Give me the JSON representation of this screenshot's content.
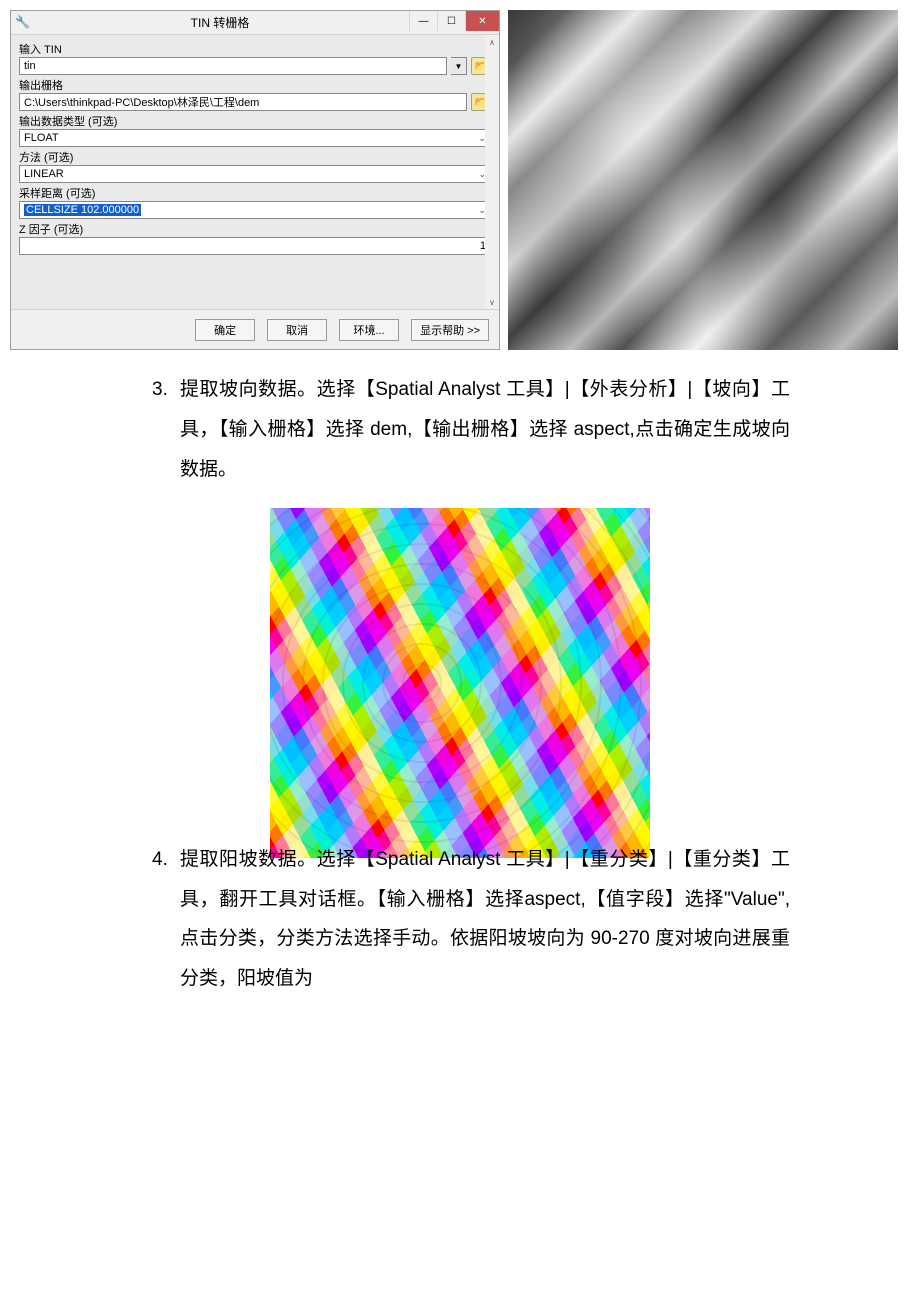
{
  "dialog": {
    "title": "TIN 转栅格",
    "labels": {
      "input_tin": "输入 TIN",
      "output_raster": "输出栅格",
      "output_type": "输出数据类型 (可选)",
      "method": "方法 (可选)",
      "sampling": "采样距离 (可选)",
      "zfactor": "Z 因子 (可选)"
    },
    "values": {
      "input_tin": "tin",
      "output_raster": "C:\\Users\\thinkpad-PC\\Desktop\\林泽民\\工程\\dem",
      "output_type": "FLOAT",
      "method": "LINEAR",
      "sampling": "CELLSIZE 102.000000",
      "zfactor": "1"
    },
    "buttons": {
      "ok": "确定",
      "cancel": "取消",
      "env": "环境...",
      "help": "显示帮助 >>"
    }
  },
  "step3": {
    "num": "3.",
    "text": "提取坡向数据。选择【Spatial Analyst 工具】|【外表分析】|【坡向】工具，【输入栅格】选择 dem,【输出栅格】选择 aspect,点击确定生成坡向数据。"
  },
  "step4": {
    "num": "4.",
    "text": "提取阳坡数据。选择【Spatial Analyst 工具】|【重分类】|【重分类】工具，翻开工具对话框。【输入栅格】选择aspect,【值字段】选择\"Value\",点击分类，分类方法选择手动。依据阳坡坡向为 90-270 度对坡向进展重分类，阳坡值为"
  }
}
